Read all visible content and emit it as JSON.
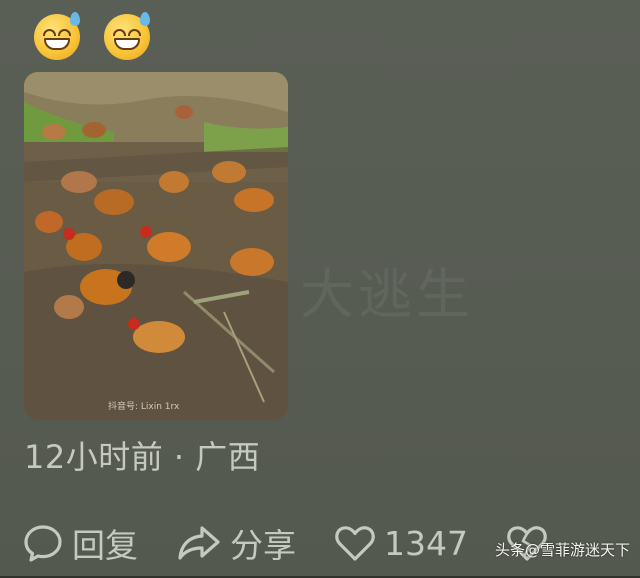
{
  "post": {
    "emojis": [
      "sweat-grin-emoji",
      "sweat-grin-emoji"
    ],
    "image": {
      "description_icon": "chicken-flock-photo",
      "caption": "抖音号: Lixin 1rx"
    },
    "timestamp": "12小时前",
    "separator": "·",
    "location": "广西",
    "background_watermark": "大逃生"
  },
  "actions": {
    "reply_label": "回复",
    "share_label": "分享",
    "like_count": "1347"
  },
  "source_watermark": "头条@雪菲游迷天下",
  "colors": {
    "background": "#565b52",
    "text": "#c5c9c0"
  }
}
